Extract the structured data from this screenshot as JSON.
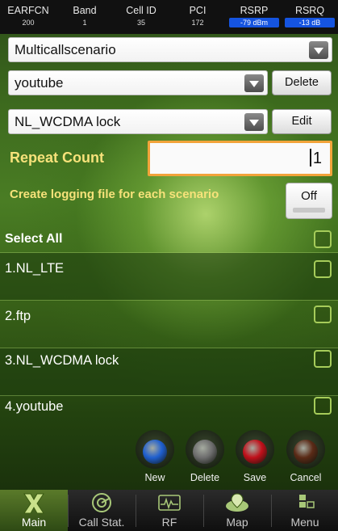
{
  "header": {
    "columns": [
      {
        "label": "EARFCN",
        "value": "200"
      },
      {
        "label": "Band",
        "value": "1"
      },
      {
        "label": "Cell ID",
        "value": "35"
      },
      {
        "label": "PCI",
        "value": "172"
      },
      {
        "label": "RSRP",
        "value": "-79 dBm"
      },
      {
        "label": "RSRQ",
        "value": "-13 dB"
      }
    ]
  },
  "form": {
    "scenario_select": "Multicallscenario",
    "scenario_item_select": "youtube",
    "delete_label": "Delete",
    "sub_item_select": "NL_WCDMA lock",
    "edit_label": "Edit",
    "repeat_count_label": "Repeat Count",
    "repeat_count_value": "1",
    "logging_label": "Create logging file for each scenario",
    "logging_toggle": "Off"
  },
  "list": {
    "select_all_label": "Select All",
    "items": [
      {
        "label": "1.NL_LTE"
      },
      {
        "label": "2.ftp"
      },
      {
        "label": "3.NL_WCDMA lock"
      },
      {
        "label": "4.youtube"
      }
    ]
  },
  "actions": [
    {
      "label": "New",
      "color": "#1f5fcf"
    },
    {
      "label": "Delete",
      "color": "#6e6e6e"
    },
    {
      "label": "Save",
      "color": "#c0101a"
    },
    {
      "label": "Cancel",
      "color": "#5a2a16"
    }
  ],
  "nav": {
    "items": [
      {
        "label": "Main",
        "icon": "x-logo-icon"
      },
      {
        "label": "Call Stat.",
        "icon": "call-stat-icon"
      },
      {
        "label": "RF",
        "icon": "rf-wave-icon"
      },
      {
        "label": "Map",
        "icon": "map-icon"
      },
      {
        "label": "Menu",
        "icon": "menu-icon"
      }
    ]
  }
}
